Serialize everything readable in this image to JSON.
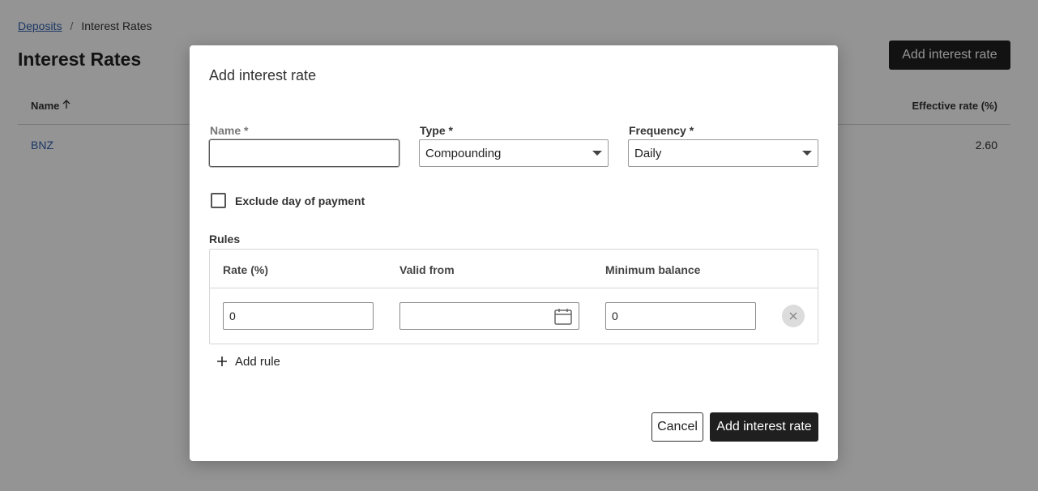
{
  "background": {
    "breadcrumb": {
      "parent": "Deposits",
      "separator": "/",
      "current": "Interest Rates"
    },
    "title": "Interest Rates",
    "action_button": "Add interest rate",
    "table": {
      "columns": {
        "name": "Name",
        "effective_rate": "Effective rate (%)"
      },
      "sort_icon": "arrow-up-icon",
      "rows": [
        {
          "name": "BNZ",
          "effective_rate": "2.60"
        }
      ]
    }
  },
  "modal": {
    "title": "Add interest rate",
    "name_field": {
      "label": "Name *",
      "value": ""
    },
    "type_field": {
      "label": "Type *",
      "selected": "Compounding"
    },
    "frequency_field": {
      "label": "Frequency *",
      "selected": "Daily"
    },
    "exclude_checkbox": {
      "label": "Exclude day of payment",
      "checked": false
    },
    "rules": {
      "label": "Rules",
      "columns": {
        "rate": "Rate (%)",
        "valid_from": "Valid from",
        "min_balance": "Minimum balance"
      },
      "rows": [
        {
          "rate": "0",
          "valid_from": "",
          "min_balance": "0"
        }
      ],
      "calendar_icon": "calendar-icon",
      "remove_icon": "close-icon"
    },
    "add_rule": {
      "icon": "plus-icon",
      "label": "Add rule"
    },
    "buttons": {
      "cancel": "Cancel",
      "submit": "Add interest rate"
    }
  }
}
